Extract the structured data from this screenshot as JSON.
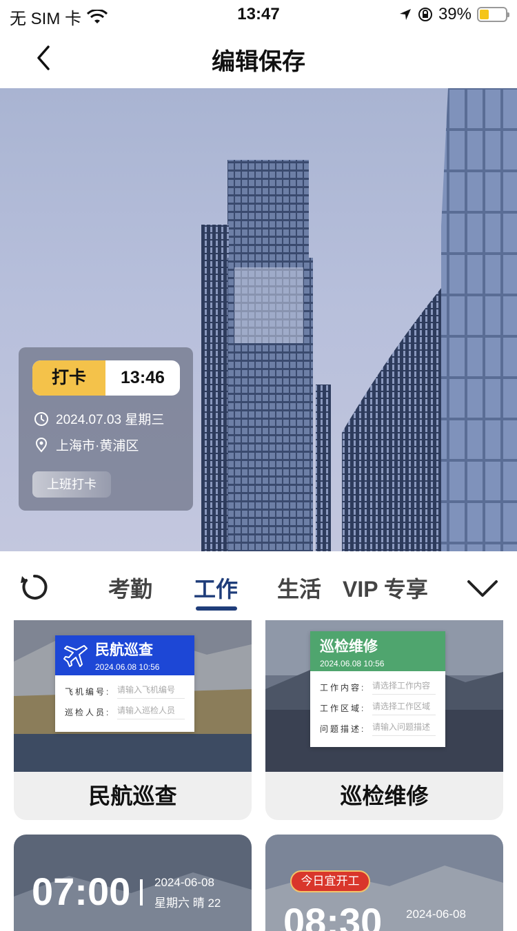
{
  "status": {
    "carrier": "无 SIM 卡",
    "time": "13:47",
    "battery": "39%"
  },
  "nav": {
    "title": "编辑保存"
  },
  "card": {
    "tag": "打卡",
    "time": "13:46",
    "date": "2024.07.03 星期三",
    "location": "上海市·黄浦区",
    "button": "上班打卡"
  },
  "tabs": [
    "考勤",
    "工作",
    "生活",
    "VIP 专享"
  ],
  "templates": [
    {
      "name": "民航巡查",
      "panel_title": "民航巡查",
      "panel_date": "2024.06.08 10:56",
      "fields": [
        {
          "k": "飞机编号:",
          "v": "请输入飞机编号"
        },
        {
          "k": "巡检人员:",
          "v": "请输入巡检人员"
        }
      ],
      "color": "#1d47d6"
    },
    {
      "name": "巡检维修",
      "panel_title": "巡检维修",
      "panel_date": "2024.06.08 10:56",
      "fields": [
        {
          "k": "工作内容:",
          "v": "请选择工作内容"
        },
        {
          "k": "工作区域:",
          "v": "请选择工作区域"
        },
        {
          "k": "问题描述:",
          "v": "请输入问题描述"
        }
      ],
      "color": "#4fa56e"
    }
  ],
  "bottom": [
    {
      "time": "07:00",
      "date": "2024-06-08",
      "sub": "星期六 晴 22"
    },
    {
      "badge": "今日宜开工",
      "time": "08:30",
      "date": "2024-06-08"
    }
  ]
}
